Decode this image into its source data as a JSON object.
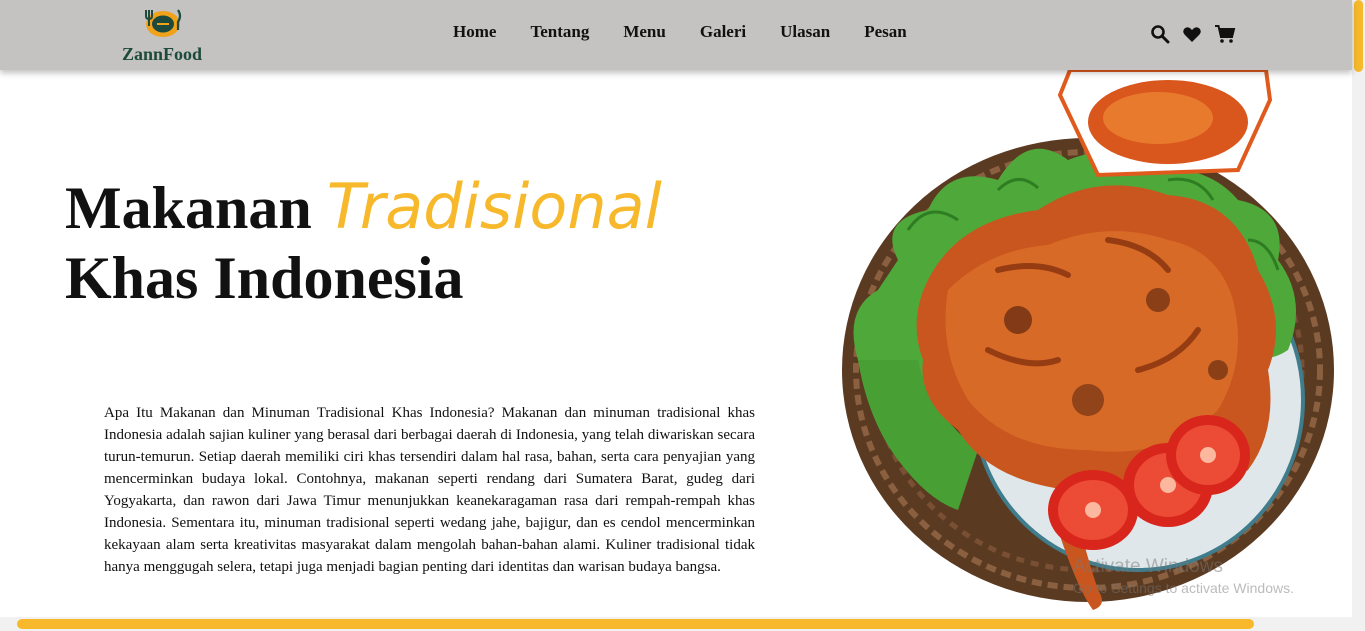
{
  "brand": {
    "name": "ZannFood"
  },
  "nav": {
    "items": [
      "Home",
      "Tentang",
      "Menu",
      "Galeri",
      "Ulasan",
      "Pesan"
    ]
  },
  "header_icons": [
    "search-icon",
    "heart-icon",
    "cart-icon"
  ],
  "hero": {
    "title_part1": "Makanan",
    "title_accent": "Tradisional",
    "title_part2": "Khas Indonesia",
    "paragraph": "Apa Itu Makanan dan Minuman Tradisional Khas Indonesia? Makanan dan minuman tradisional khas Indonesia adalah sajian kuliner yang berasal dari berbagai daerah di Indonesia, yang telah diwariskan secara turun-temurun. Setiap daerah memiliki ciri khas tersendiri dalam hal rasa, bahan, serta cara penyajian yang mencerminkan budaya lokal. Contohnya, makanan seperti rendang dari Sumatera Barat, gudeg dari Yogyakarta, dan rawon dari Jawa Timur menunjukkan keanekaragaman rasa dari rempah-rempah khas Indonesia. Sementara itu, minuman tradisional seperti wedang jahe, bajigur, dan es cendol mencerminkan kekayaan alam serta kreativitas masyarakat dalam mengolah bahan-bahan alami. Kuliner tradisional tidak hanya menggugah selera, tetapi juga menjadi bagian penting dari identitas dan warisan budaya bangsa.",
    "image": "grilled-chicken-plate"
  },
  "watermark": {
    "line1": "Activate Windows",
    "line2": "Go to Settings to activate Windows."
  },
  "colors": {
    "accent": "#f7b92b",
    "header_bg": "#c4c3c1",
    "logo_green": "#1d4a3c",
    "logo_orange": "#f0a21a"
  }
}
